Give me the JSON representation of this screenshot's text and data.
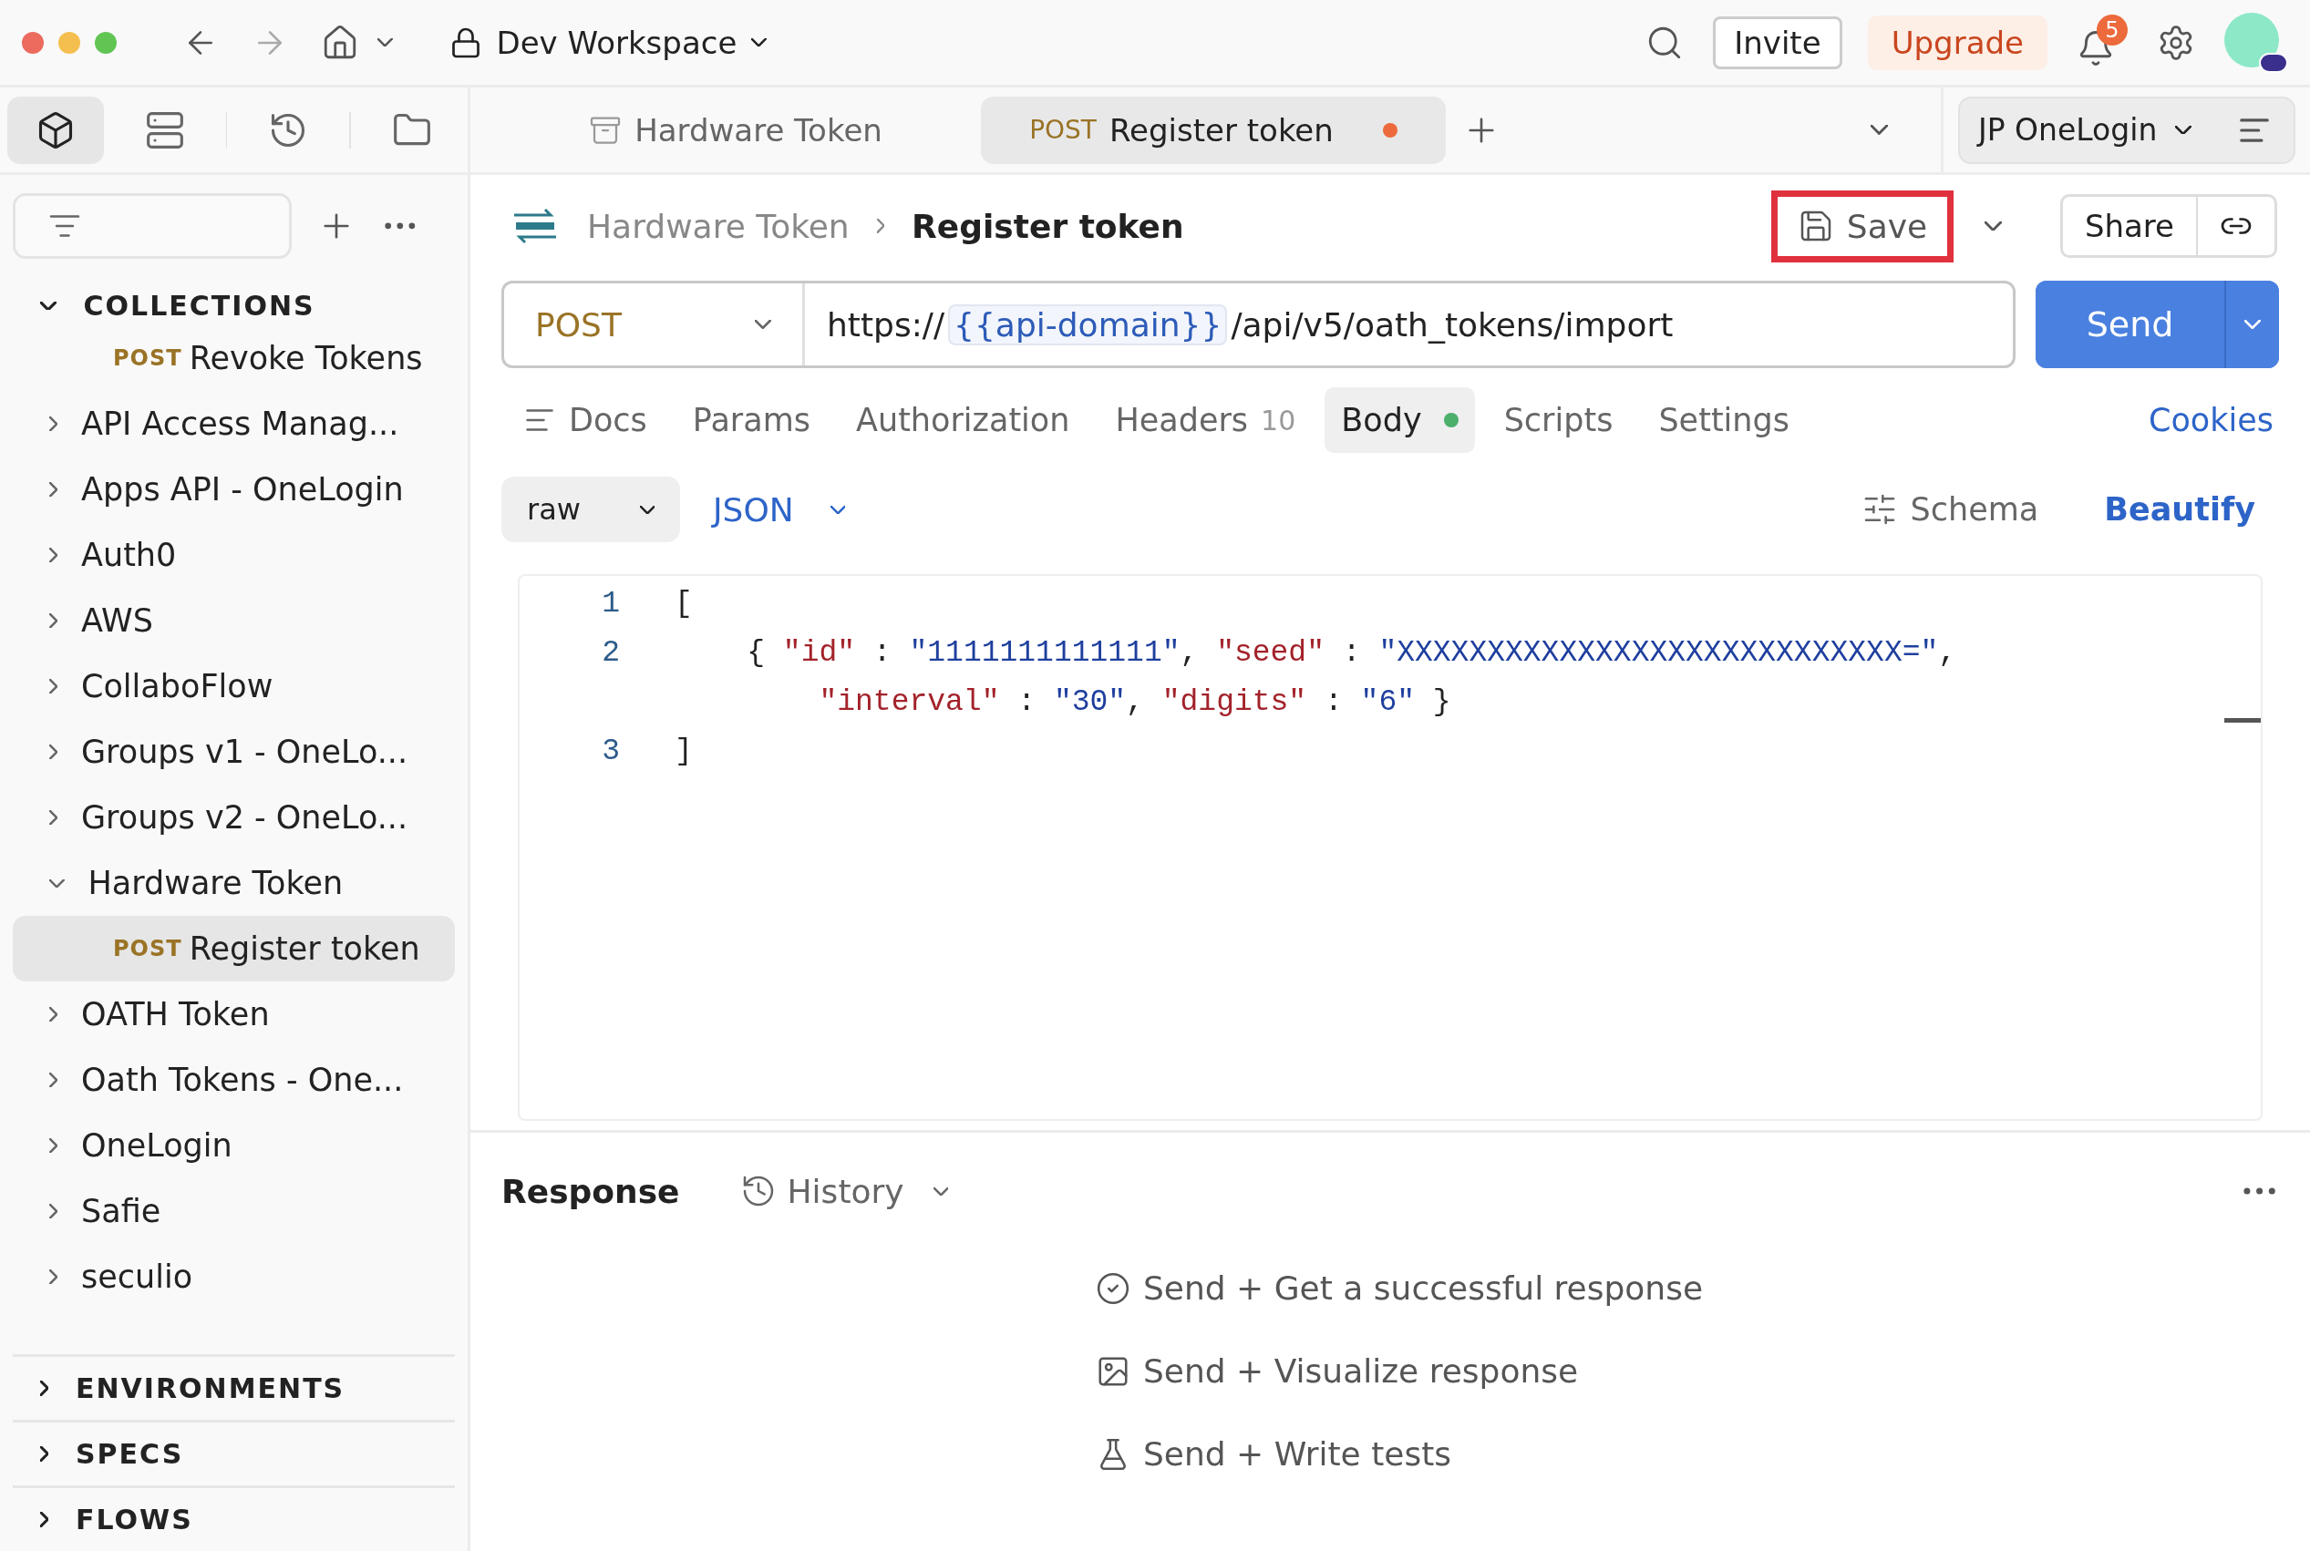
{
  "topbar": {
    "workspace": "Dev Workspace",
    "invite": "Invite",
    "upgrade": "Upgrade",
    "notifications": "5"
  },
  "sidebar": {
    "views": [
      {
        "kind": "collections",
        "selected": true
      },
      {
        "kind": "environments",
        "selected": false
      },
      {
        "kind": "history",
        "selected": false
      },
      {
        "kind": "files",
        "selected": false
      }
    ],
    "collections": {
      "label": "COLLECTIONS",
      "expanded": true,
      "items": [
        {
          "kind": "request",
          "method": "POST",
          "label": "Revoke Tokens",
          "selected": false
        },
        {
          "kind": "folder",
          "label": "API Access Manag...",
          "expanded": false
        },
        {
          "kind": "folder",
          "label": "Apps API - OneLogin",
          "expanded": false
        },
        {
          "kind": "folder",
          "label": "Auth0",
          "expanded": false
        },
        {
          "kind": "folder",
          "label": "AWS",
          "expanded": false
        },
        {
          "kind": "folder",
          "label": "CollaboFlow",
          "expanded": false
        },
        {
          "kind": "folder",
          "label": "Groups v1 - OneLo...",
          "expanded": false
        },
        {
          "kind": "folder",
          "label": "Groups v2 - OneLo...",
          "expanded": false
        },
        {
          "kind": "folder",
          "label": "Hardware Token",
          "expanded": true,
          "children": [
            {
              "kind": "request",
              "method": "POST",
              "label": "Register token",
              "selected": true
            }
          ]
        },
        {
          "kind": "folder",
          "label": "OATH Token",
          "expanded": false
        },
        {
          "kind": "folder",
          "label": "Oath Tokens - One...",
          "expanded": false
        },
        {
          "kind": "folder",
          "label": "OneLogin",
          "expanded": false
        },
        {
          "kind": "folder",
          "label": "Safie",
          "expanded": false
        },
        {
          "kind": "folder",
          "label": "seculio",
          "expanded": false
        }
      ]
    },
    "sections": [
      {
        "label": "ENVIRONMENTS",
        "expanded": false
      },
      {
        "label": "SPECS",
        "expanded": false
      },
      {
        "label": "FLOWS",
        "expanded": false
      }
    ]
  },
  "tabs": [
    {
      "kind": "folder",
      "label": "Hardware Token",
      "selected": false,
      "unsaved": false
    },
    {
      "kind": "request",
      "method": "POST",
      "label": "Register token",
      "selected": true,
      "unsaved": true
    }
  ],
  "environment": "JP OneLogin",
  "breadcrumb": [
    "Hardware Token",
    "Register token"
  ],
  "save": {
    "label": "Save",
    "highlighted": true
  },
  "share": "Share",
  "request": {
    "method": "POST",
    "url_prefix": "https://",
    "url_variable": "{{api-domain}}",
    "url_suffix": "/api/v5/oath_tokens/import",
    "send": "Send"
  },
  "request_tabs": [
    {
      "kind": "docs",
      "label": "Docs",
      "selected": false
    },
    {
      "label": "Params",
      "selected": false
    },
    {
      "label": "Authorization",
      "selected": false
    },
    {
      "label": "Headers",
      "count": "10",
      "selected": false
    },
    {
      "label": "Body",
      "selected": true,
      "has_content": true
    },
    {
      "label": "Scripts",
      "selected": false
    },
    {
      "label": "Settings",
      "selected": false
    }
  ],
  "cookies": "Cookies",
  "body": {
    "mode": "raw",
    "language": "JSON",
    "schema": "Schema",
    "beautify": "Beautify",
    "lines": [
      {
        "number": "1",
        "wraps": [
          {
            "segments": [
              {
                "kind": "punct",
                "text": "["
              }
            ]
          }
        ]
      },
      {
        "number": "2",
        "wraps": [
          {
            "segments": [
              {
                "kind": "punct",
                "text": "    { "
              },
              {
                "kind": "key",
                "text": "\"id\""
              },
              {
                "kind": "punct",
                "text": " : "
              },
              {
                "kind": "string",
                "text": "\"1111111111111\""
              },
              {
                "kind": "punct",
                "text": ", "
              },
              {
                "kind": "key",
                "text": "\"seed\""
              },
              {
                "kind": "punct",
                "text": " : "
              },
              {
                "kind": "string",
                "text": "\"XXXXXXXXXXXXXXXXXXXXXXXXXXXX=\""
              },
              {
                "kind": "punct",
                "text": ","
              }
            ]
          },
          {
            "kind": "continuation",
            "segments": [
              {
                "kind": "key",
                "text": "\"interval\""
              },
              {
                "kind": "punct",
                "text": " : "
              },
              {
                "kind": "string",
                "text": "\"30\""
              },
              {
                "kind": "punct",
                "text": ", "
              },
              {
                "kind": "key",
                "text": "\"digits\""
              },
              {
                "kind": "punct",
                "text": " : "
              },
              {
                "kind": "string",
                "text": "\"6\""
              },
              {
                "kind": "punct",
                "text": " }"
              }
            ]
          }
        ]
      },
      {
        "number": "3",
        "wraps": [
          {
            "segments": [
              {
                "kind": "punct",
                "text": "]"
              }
            ]
          }
        ]
      }
    ]
  },
  "response": {
    "title": "Response",
    "history": "History",
    "actions": [
      {
        "kind": "success",
        "label": "Send + Get a successful response"
      },
      {
        "kind": "visualize",
        "label": "Send + Visualize response"
      },
      {
        "kind": "tests",
        "label": "Send + Write tests"
      }
    ]
  }
}
